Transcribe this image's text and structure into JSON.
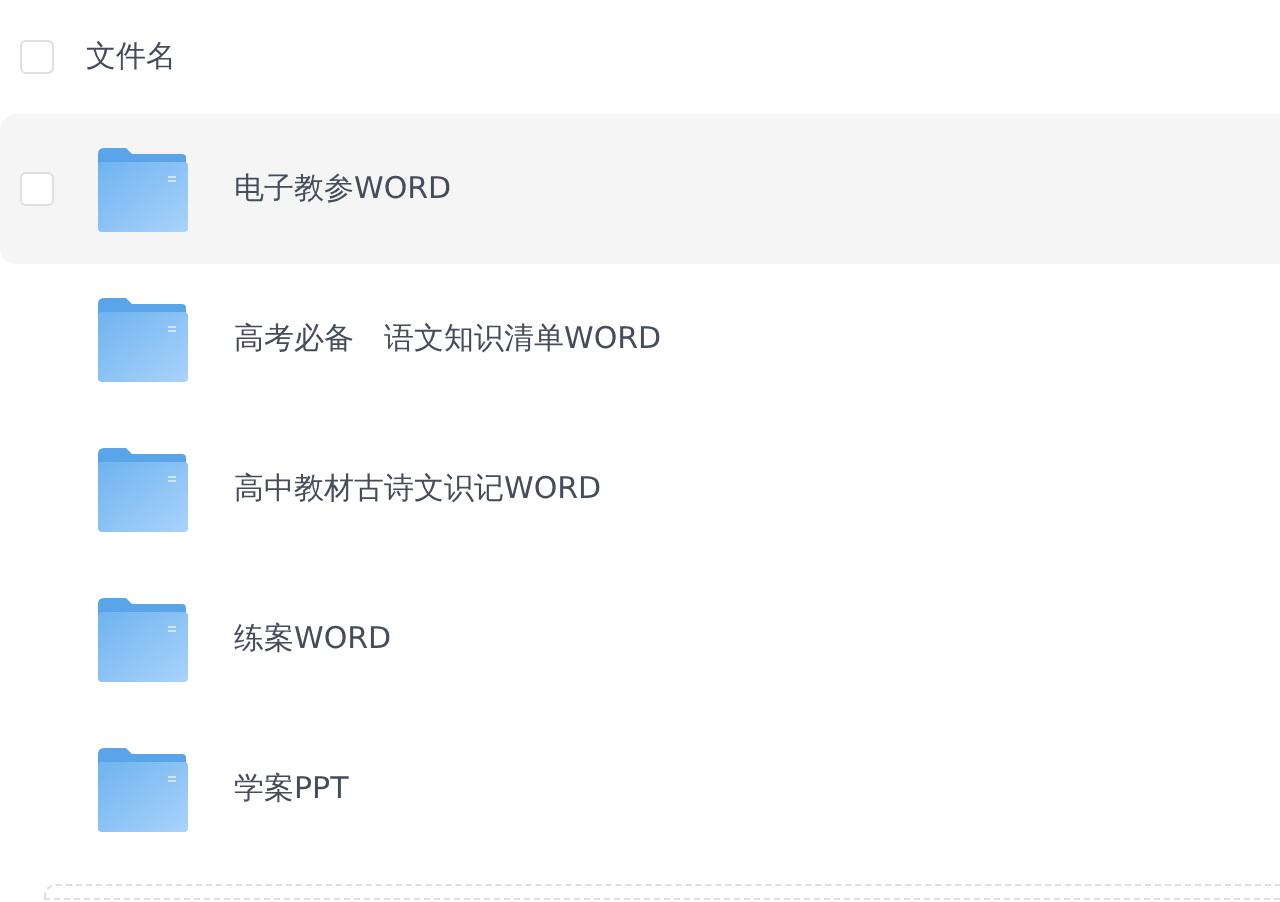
{
  "header": {
    "label": "文件名",
    "checked": false
  },
  "files": [
    {
      "name": "电子教参WORD",
      "hovered": true,
      "checked": false
    },
    {
      "name": "高考必备　语文知识清单WORD",
      "hovered": false
    },
    {
      "name": "高中教材古诗文识记WORD",
      "hovered": false
    },
    {
      "name": "练案WORD",
      "hovered": false
    },
    {
      "name": "学案PPT",
      "hovered": false
    }
  ]
}
